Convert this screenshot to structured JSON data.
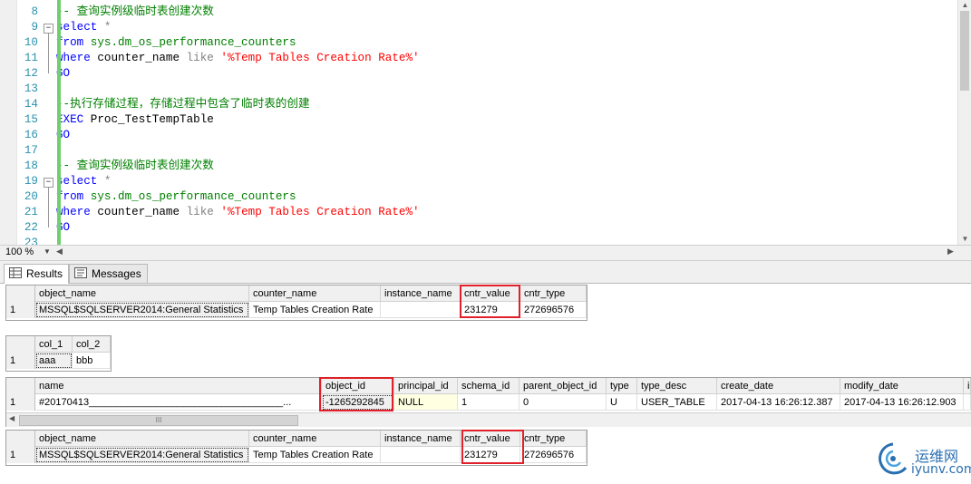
{
  "editor": {
    "lines": [
      {
        "n": "8",
        "fold": "",
        "parts": [
          [
            "cmt",
            "-- 查询实例级临时表创建次数"
          ]
        ]
      },
      {
        "n": "9",
        "fold": "minus",
        "parts": [
          [
            "kw",
            "select"
          ],
          [
            "plain",
            " "
          ],
          [
            "gray",
            "*"
          ]
        ]
      },
      {
        "n": "10",
        "fold": "",
        "parts": [
          [
            "kw",
            "from"
          ],
          [
            "plain",
            " "
          ],
          [
            "sys",
            "sys.dm_os_performance_counters"
          ]
        ]
      },
      {
        "n": "11",
        "fold": "",
        "parts": [
          [
            "kw",
            "where"
          ],
          [
            "plain",
            " counter_name "
          ],
          [
            "gray",
            "like"
          ],
          [
            "plain",
            " "
          ],
          [
            "str",
            "'%Temp Tables Creation Rate%'"
          ]
        ]
      },
      {
        "n": "12",
        "fold": "",
        "parts": [
          [
            "kw",
            "GO"
          ]
        ]
      },
      {
        "n": "13",
        "fold": "",
        "parts": []
      },
      {
        "n": "14",
        "fold": "",
        "parts": [
          [
            "cmt",
            "--执行存储过程，存储过程中包含了临时表的创建"
          ]
        ]
      },
      {
        "n": "15",
        "fold": "",
        "parts": [
          [
            "kw",
            "EXEC"
          ],
          [
            "plain",
            " Proc_TestTempTable"
          ]
        ]
      },
      {
        "n": "16",
        "fold": "",
        "parts": [
          [
            "kw",
            "GO"
          ]
        ]
      },
      {
        "n": "17",
        "fold": "",
        "parts": []
      },
      {
        "n": "18",
        "fold": "",
        "parts": [
          [
            "cmt",
            "-- 查询实例级临时表创建次数"
          ]
        ]
      },
      {
        "n": "19",
        "fold": "minus",
        "parts": [
          [
            "kw",
            "select"
          ],
          [
            "plain",
            " "
          ],
          [
            "gray",
            "*"
          ]
        ]
      },
      {
        "n": "20",
        "fold": "",
        "parts": [
          [
            "kw",
            "from"
          ],
          [
            "plain",
            " "
          ],
          [
            "sys",
            "sys.dm_os_performance_counters"
          ]
        ]
      },
      {
        "n": "21",
        "fold": "",
        "parts": [
          [
            "kw",
            "where"
          ],
          [
            "plain",
            " counter_name "
          ],
          [
            "gray",
            "like"
          ],
          [
            "plain",
            " "
          ],
          [
            "str",
            "'%Temp Tables Creation Rate%'"
          ]
        ]
      },
      {
        "n": "22",
        "fold": "",
        "parts": [
          [
            "kw",
            "GO"
          ]
        ]
      },
      {
        "n": "23",
        "fold": "",
        "parts": []
      }
    ]
  },
  "zoom": {
    "label": "100 %"
  },
  "tabs": {
    "results": "Results",
    "messages": "Messages"
  },
  "grids": {
    "g1": {
      "headers": [
        "object_name",
        "counter_name",
        "instance_name",
        "cntr_value",
        "cntr_type"
      ],
      "row_num": "1",
      "row": [
        "MSSQL$SQLSERVER2014:General Statistics",
        "Temp Tables Creation Rate",
        "",
        "231279",
        "272696576"
      ]
    },
    "g2": {
      "headers": [
        "col_1",
        "col_2"
      ],
      "row_num": "1",
      "row": [
        "aaa",
        "bbb"
      ]
    },
    "g3": {
      "headers": [
        "name",
        "object_id",
        "principal_id",
        "schema_id",
        "parent_object_id",
        "type",
        "type_desc",
        "create_date",
        "modify_date",
        "i"
      ],
      "row_num": "1",
      "row": [
        "#20170413___________________________________...",
        "-1265292845",
        "NULL",
        "1",
        "0",
        "U",
        "USER_TABLE",
        "2017-04-13 16:26:12.387",
        "2017-04-13 16:26:12.903",
        ""
      ],
      "scroll_thumb": "III"
    },
    "g4": {
      "headers": [
        "object_name",
        "counter_name",
        "instance_name",
        "cntr_value",
        "cntr_type"
      ],
      "row_num": "1",
      "row": [
        "MSSQL$SQLSERVER2014:General Statistics",
        "Temp Tables Creation Rate",
        "",
        "231279",
        "272696576"
      ]
    }
  },
  "watermark": {
    "cn": "运维网",
    "en": "iyunv.com"
  }
}
